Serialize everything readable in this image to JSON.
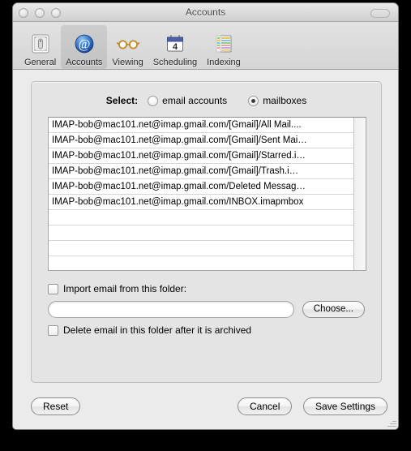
{
  "window": {
    "title": "Accounts",
    "controls": {
      "close": "close",
      "minimize": "minimize",
      "zoom": "zoom"
    },
    "toolbar_toggle": "toolbar-toggle"
  },
  "toolbar": {
    "items": [
      {
        "label": "General",
        "icon": "general-icon",
        "selected": false
      },
      {
        "label": "Accounts",
        "icon": "at-sign-icon",
        "selected": true
      },
      {
        "label": "Viewing",
        "icon": "glasses-icon",
        "selected": false
      },
      {
        "label": "Scheduling",
        "icon": "calendar-icon",
        "selected": false
      },
      {
        "label": "Indexing",
        "icon": "index-list-icon",
        "selected": false
      }
    ],
    "calendar_day": "4"
  },
  "select": {
    "label": "Select:",
    "options": [
      {
        "label": "email accounts",
        "checked": false
      },
      {
        "label": "mailboxes",
        "checked": true
      }
    ]
  },
  "mailbox_list": {
    "rows": [
      "IMAP-bob@mac101.net@imap.gmail.com/[Gmail]/All Mail....",
      "IMAP-bob@mac101.net@imap.gmail.com/[Gmail]/Sent Mai…",
      "IMAP-bob@mac101.net@imap.gmail.com/[Gmail]/Starred.i…",
      "IMAP-bob@mac101.net@imap.gmail.com/[Gmail]/Trash.i…",
      "IMAP-bob@mac101.net@imap.gmail.com/Deleted Messag…",
      "IMAP-bob@mac101.net@imap.gmail.com/INBOX.imapmbox",
      "",
      "",
      "",
      ""
    ]
  },
  "import": {
    "checkbox_label": "Import email from this folder:",
    "checked": false,
    "path_value": "",
    "path_placeholder": "",
    "choose_label": "Choose..."
  },
  "delete_option": {
    "label": "Delete email in this folder after it is archived",
    "checked": false
  },
  "buttons": {
    "reset": "Reset",
    "cancel": "Cancel",
    "save": "Save Settings"
  },
  "colors": {
    "window_bg": "#ededed",
    "group_bg": "#e4e4e4",
    "list_bg": "#ffffff",
    "accent_blue": "#2a63b8",
    "text": "#000000"
  }
}
